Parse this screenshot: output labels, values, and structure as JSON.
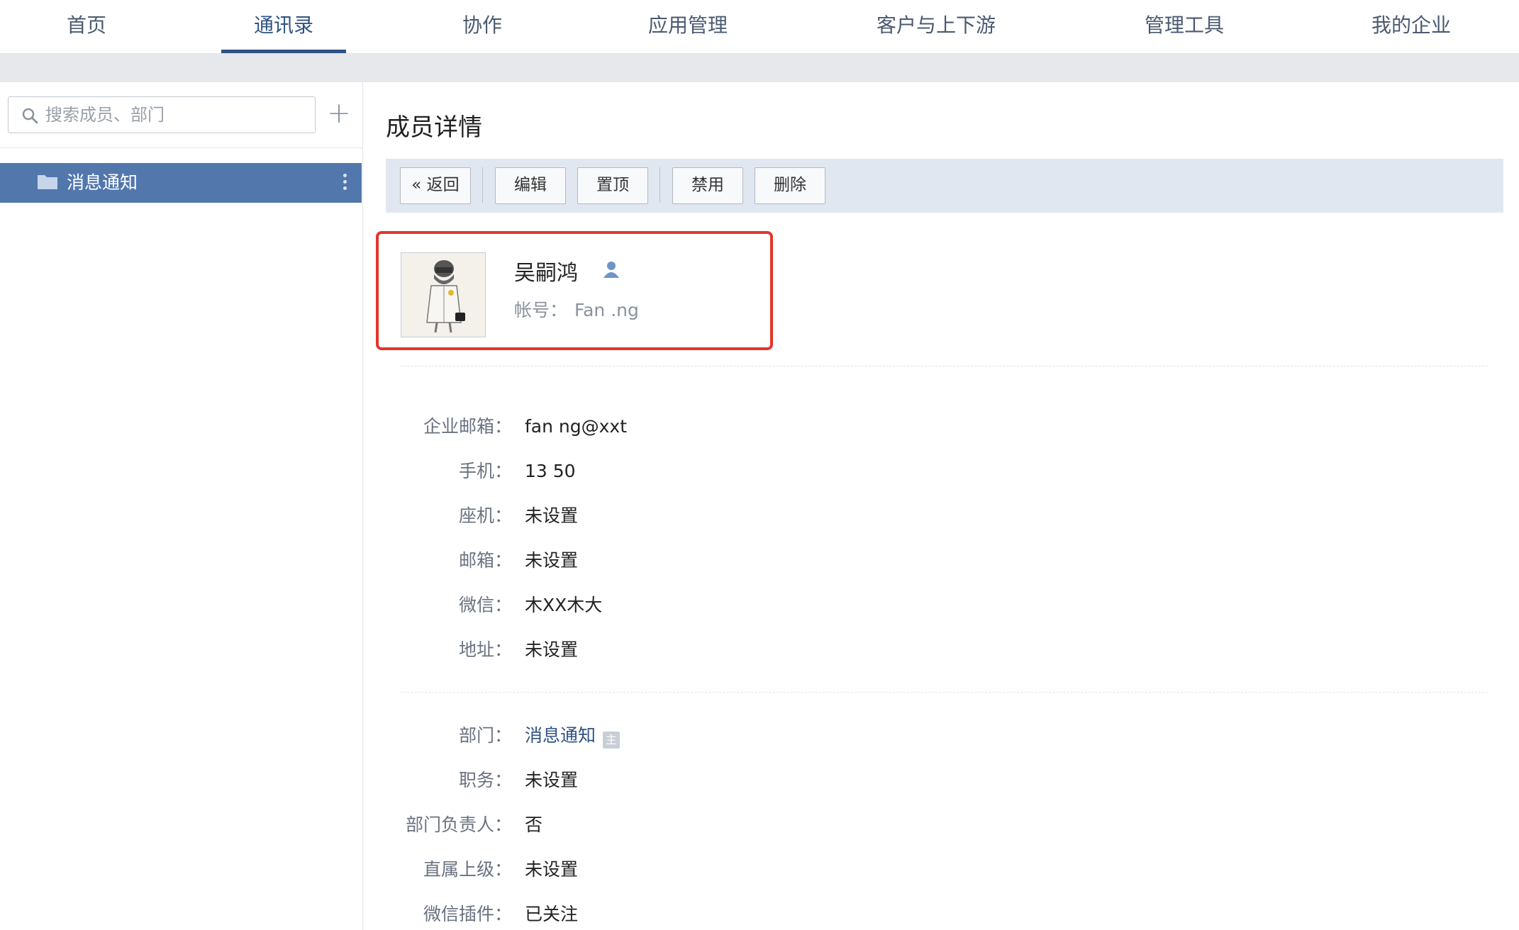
{
  "nav": {
    "tabs": [
      {
        "label": "首页"
      },
      {
        "label": "通讯录"
      },
      {
        "label": "协作"
      },
      {
        "label": "应用管理"
      },
      {
        "label": "客户与上下游"
      },
      {
        "label": "管理工具"
      },
      {
        "label": "我的企业"
      }
    ],
    "active": "通讯录"
  },
  "sidebar": {
    "search_placeholder": "搜索成员、部门",
    "add_symbol": "+",
    "departments": [
      {
        "label": "消息通知"
      }
    ]
  },
  "main": {
    "title": "成员详情",
    "toolbar": {
      "back": "« 返回",
      "edit": "编辑",
      "pin": "置顶",
      "disable": "禁用",
      "delete": "删除"
    },
    "profile": {
      "name": "吴嗣鸿",
      "account_label": "帐号：",
      "account_value": "Fan      .ng"
    },
    "contact": [
      {
        "key": "企业邮箱：",
        "value": "fan      ng@xxt             "
      },
      {
        "key": "手机：",
        "value": "13      50  "
      },
      {
        "key": "座机：",
        "value": "未设置"
      },
      {
        "key": "邮箱：",
        "value": "未设置"
      },
      {
        "key": "微信：",
        "value": "木XX木大"
      },
      {
        "key": "地址：",
        "value": "未设置"
      }
    ],
    "org": [
      {
        "key": "部门：",
        "value": "消息通知",
        "badge": "主"
      },
      {
        "key": "职务：",
        "value": "未设置"
      },
      {
        "key": "部门负责人：",
        "value": "否"
      },
      {
        "key": "直属上级：",
        "value": "未设置"
      },
      {
        "key": "微信插件：",
        "value": "已关注"
      }
    ]
  },
  "colors": {
    "accent": "#2f5383",
    "selected_dept_bg": "#5277ad",
    "toolbar_bg": "#e1e7f1",
    "highlight_border": "#e2362a"
  }
}
